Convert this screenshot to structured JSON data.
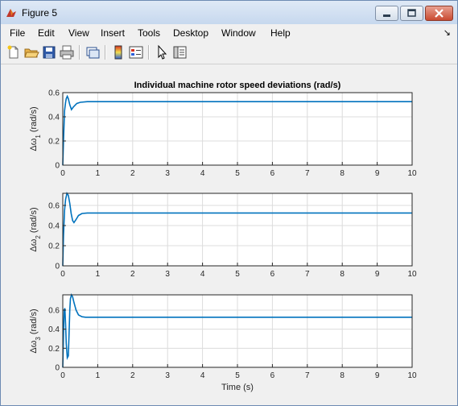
{
  "window": {
    "title": "Figure 5"
  },
  "menu": [
    "File",
    "Edit",
    "View",
    "Insert",
    "Tools",
    "Desktop",
    "Window",
    "Help"
  ],
  "toolbar_icons": [
    "new-file-icon",
    "open-folder-icon",
    "save-icon",
    "print-icon",
    "link-figure-icon",
    "insert-colorbar-icon",
    "insert-legend-icon",
    "edit-plot-arrow-icon",
    "property-inspector-icon"
  ],
  "colors": {
    "line": "#0072bd",
    "grid": "#dcdcdc",
    "axes_bg": "#ffffff",
    "figure_bg": "#f0f0f0"
  },
  "chart_data": [
    {
      "type": "line",
      "title": "Individual machine rotor speed deviations (rad/s)",
      "ylabel_parts": [
        "Δω",
        "1",
        " (rad/s)"
      ],
      "xlabel": "",
      "xlim": [
        0,
        10
      ],
      "ylim": [
        0,
        0.6
      ],
      "xticks": [
        0,
        1,
        2,
        3,
        4,
        5,
        6,
        7,
        8,
        9,
        10
      ],
      "yticks": [
        0,
        0.2,
        0.4,
        0.6
      ],
      "yticklabels": [
        "0",
        "0.2",
        "0.4",
        "0.6"
      ],
      "grid": true,
      "series": [
        {
          "x": [
            0,
            0.02,
            0.05,
            0.08,
            0.1,
            0.13,
            0.16,
            0.2,
            0.25,
            0.3,
            0.4,
            0.5,
            0.7,
            1.0,
            2,
            10
          ],
          "y": [
            0,
            0.2,
            0.45,
            0.52,
            0.55,
            0.57,
            0.55,
            0.5,
            0.46,
            0.48,
            0.51,
            0.52,
            0.525,
            0.525,
            0.525,
            0.525
          ]
        }
      ]
    },
    {
      "type": "line",
      "title": "",
      "ylabel_parts": [
        "Δω",
        "2",
        " (rad/s)"
      ],
      "xlabel": "",
      "xlim": [
        0,
        10
      ],
      "ylim": [
        0,
        0.72
      ],
      "xticks": [
        0,
        1,
        2,
        3,
        4,
        5,
        6,
        7,
        8,
        9,
        10
      ],
      "yticks": [
        0,
        0.2,
        0.4,
        0.6
      ],
      "yticklabels": [
        "0",
        "0.2",
        "0.4",
        "0.6"
      ],
      "grid": true,
      "series": [
        {
          "x": [
            0,
            0.02,
            0.05,
            0.08,
            0.12,
            0.16,
            0.2,
            0.24,
            0.28,
            0.32,
            0.38,
            0.45,
            0.55,
            0.7,
            1.0,
            2,
            10
          ],
          "y": [
            0,
            0.3,
            0.55,
            0.66,
            0.72,
            0.7,
            0.62,
            0.52,
            0.45,
            0.43,
            0.46,
            0.5,
            0.52,
            0.525,
            0.525,
            0.525,
            0.525
          ]
        }
      ]
    },
    {
      "type": "line",
      "title": "",
      "ylabel_parts": [
        "Δω",
        "3",
        " (rad/s)"
      ],
      "xlabel": "Time (s)",
      "xlim": [
        0,
        10
      ],
      "ylim": [
        0,
        0.76
      ],
      "xticks": [
        0,
        1,
        2,
        3,
        4,
        5,
        6,
        7,
        8,
        9,
        10
      ],
      "yticks": [
        0,
        0.2,
        0.4,
        0.6
      ],
      "yticklabels": [
        "0",
        "0.2",
        "0.4",
        "0.6"
      ],
      "grid": true,
      "series": [
        {
          "x": [
            0,
            0.02,
            0.04,
            0.06,
            0.08,
            0.1,
            0.13,
            0.16,
            0.18,
            0.2,
            0.22,
            0.25,
            0.28,
            0.32,
            0.38,
            0.45,
            0.55,
            0.65,
            0.8,
            1.0,
            2,
            10
          ],
          "y": [
            0,
            0.35,
            0.6,
            0.62,
            0.45,
            0.25,
            0.1,
            0.12,
            0.35,
            0.6,
            0.72,
            0.76,
            0.74,
            0.68,
            0.6,
            0.55,
            0.53,
            0.525,
            0.525,
            0.525,
            0.525,
            0.525
          ]
        }
      ]
    }
  ]
}
